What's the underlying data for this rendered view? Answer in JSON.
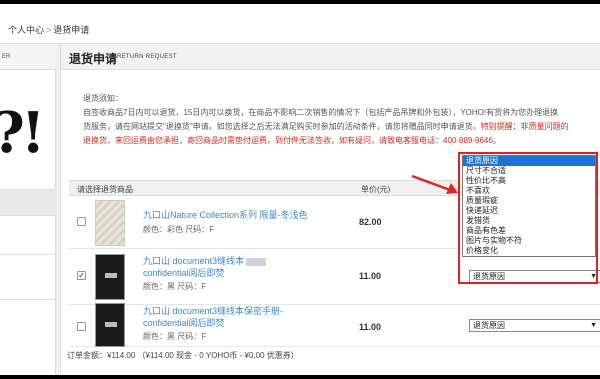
{
  "breadcrumb": {
    "prefix": "个人中心",
    "current": "退货申请"
  },
  "sidebar": {
    "header_fragment": "ER",
    "logo_fragment": "?!"
  },
  "page": {
    "title_cn": "退货申请",
    "title_en": "RETURN REQUEST"
  },
  "notice": {
    "line1": "退货须知：",
    "line2": "自签收商品7日内可以退货，15日内可以换货，在商品不影响二次销售的情况下（包括产品吊牌和外包装），YOHO!有货将为您办理退换",
    "line3": "货服务，请在网站提交\"退换货\"申请。如您选择之后无法满足购买时参加的活动条件，请您将赠品同时申请退货。",
    "line3_red": "特别提醒：非质量问题的",
    "line4_red": "退换货，来回运费由您承担，寄回商品时需垫付运费，到付件无法签收，如有疑问，请致电客服电话：400-889-9646。"
  },
  "table": {
    "header_goods": "请选择退货商品",
    "header_price": "单价(元)"
  },
  "items": [
    {
      "checked": false,
      "checkmark": "",
      "name": "九口山Nature Collection系列 限量-冬浅色",
      "name2": "",
      "attr": "颜色：彩色 尺码：F",
      "price": "82.00",
      "select": "退货原因"
    },
    {
      "checked": true,
      "checkmark": "✓",
      "name": "九口山 document3缝线本",
      "name2": "confidential阅后即焚",
      "attr": "颜色：黑 尺码：F",
      "price": "11.00",
      "select": "退货原因"
    },
    {
      "checked": false,
      "checkmark": "",
      "name": "九口山 document3缝线本保密手册-",
      "name2": "confidential阅后即焚",
      "attr": "颜色：黑 尺码：F",
      "price": "11.00",
      "select": "退货原因"
    }
  ],
  "dropdown": {
    "options": [
      "退货原因",
      "尺寸不合适",
      "性价比不高",
      "不喜欢",
      "质量瑕疵",
      "快递延迟",
      "发错货",
      "商品有色差",
      "图片与实物不符",
      "价格变化"
    ],
    "selected_index": 0
  },
  "order_total": "订单金额：¥114.00 （¥114.00 现金 - 0 YOHO币 - ¥0.00 优惠券）",
  "colors": {
    "link": "#3b8ac4",
    "warning": "#d8281f",
    "highlight": "#e2231a",
    "selected": "#1e73d6"
  },
  "icons": {
    "select_arrow": "▼",
    "checkbox_check": "✓",
    "pointer_arrow": "red-arrow"
  }
}
